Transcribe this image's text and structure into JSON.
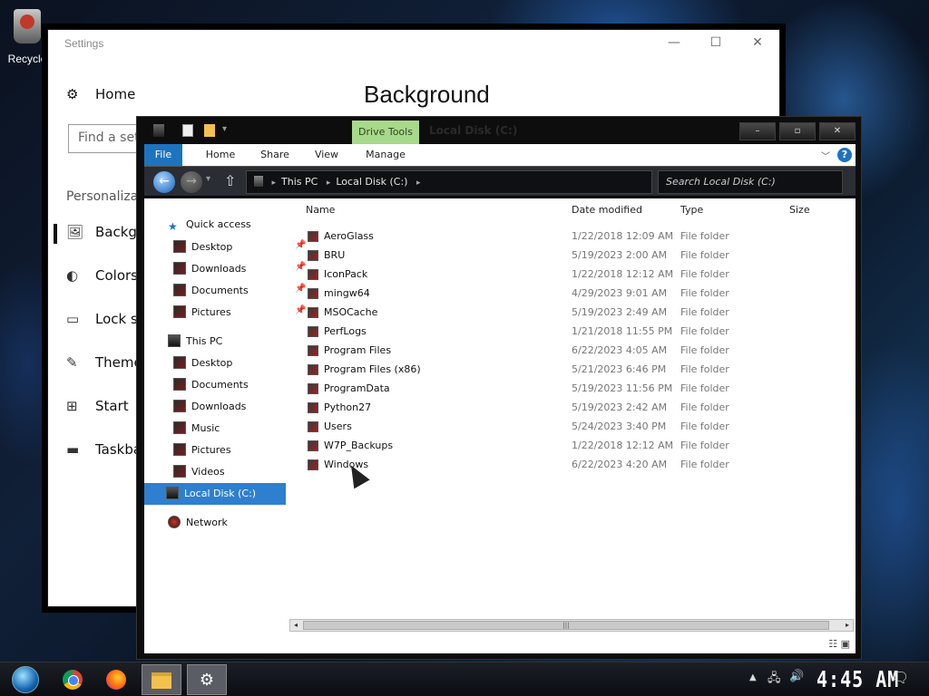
{
  "desktop": {
    "recycle_label": "Recycle"
  },
  "settings": {
    "title": "Settings",
    "heading": "Background",
    "home_label": "Home",
    "search_placeholder": "Find a set",
    "group_label": "Personaliza",
    "nav": [
      {
        "label": "Backgr",
        "icon": "image-icon",
        "selected": true
      },
      {
        "label": "Colors",
        "icon": "palette-icon"
      },
      {
        "label": "Lock sc",
        "icon": "lock-screen-icon"
      },
      {
        "label": "Theme",
        "icon": "theme-icon"
      },
      {
        "label": "Start",
        "icon": "start-icon"
      },
      {
        "label": "Taskba",
        "icon": "taskbar-icon"
      }
    ],
    "caption": {
      "minimize": "—",
      "maximize": "☐",
      "close": "✕"
    }
  },
  "explorer": {
    "title": "Local Disk (C:)",
    "contextual_tab": "Drive Tools",
    "tabs": [
      "File",
      "Home",
      "Share",
      "View",
      "Manage"
    ],
    "caption": {
      "minimize": "–",
      "maximize": "▫",
      "close": "✕"
    },
    "breadcrumb": [
      "This PC",
      "Local Disk (C:)"
    ],
    "search_placeholder": "Search Local Disk (C:)",
    "nav_pane": {
      "quick_access": "Quick access",
      "quick_items": [
        "Desktop",
        "Downloads",
        "Documents",
        "Pictures"
      ],
      "this_pc": "This PC",
      "pc_items": [
        "Desktop",
        "Documents",
        "Downloads",
        "Music",
        "Pictures",
        "Videos"
      ],
      "selected": "Local Disk (C:)",
      "network": "Network"
    },
    "columns": [
      "Name",
      "Date modified",
      "Type",
      "Size"
    ],
    "files": [
      {
        "name": "AeroGlass",
        "date": "1/22/2018 12:09 AM",
        "type": "File folder"
      },
      {
        "name": "BRU",
        "date": "5/19/2023 2:00 AM",
        "type": "File folder"
      },
      {
        "name": "IconPack",
        "date": "1/22/2018 12:12 AM",
        "type": "File folder"
      },
      {
        "name": "mingw64",
        "date": "4/29/2023 9:01 AM",
        "type": "File folder"
      },
      {
        "name": "MSOCache",
        "date": "5/19/2023 2:49 AM",
        "type": "File folder"
      },
      {
        "name": "PerfLogs",
        "date": "1/21/2018 11:55 PM",
        "type": "File folder"
      },
      {
        "name": "Program Files",
        "date": "6/22/2023 4:05 AM",
        "type": "File folder"
      },
      {
        "name": "Program Files (x86)",
        "date": "5/21/2023 6:46 PM",
        "type": "File folder"
      },
      {
        "name": "ProgramData",
        "date": "5/19/2023 11:56 PM",
        "type": "File folder"
      },
      {
        "name": "Python27",
        "date": "5/19/2023 2:42 AM",
        "type": "File folder"
      },
      {
        "name": "Users",
        "date": "5/24/2023 3:40 PM",
        "type": "File folder"
      },
      {
        "name": "W7P_Backups",
        "date": "1/22/2018 12:12 AM",
        "type": "File folder"
      },
      {
        "name": "Windows",
        "date": "6/22/2023 4:20 AM",
        "type": "File folder"
      }
    ]
  },
  "taskbar": {
    "clock": "4:45 AM",
    "items": [
      "start-orb-icon",
      "chrome-icon",
      "firefox-icon",
      "file-explorer-icon",
      "settings-gear-icon"
    ]
  }
}
